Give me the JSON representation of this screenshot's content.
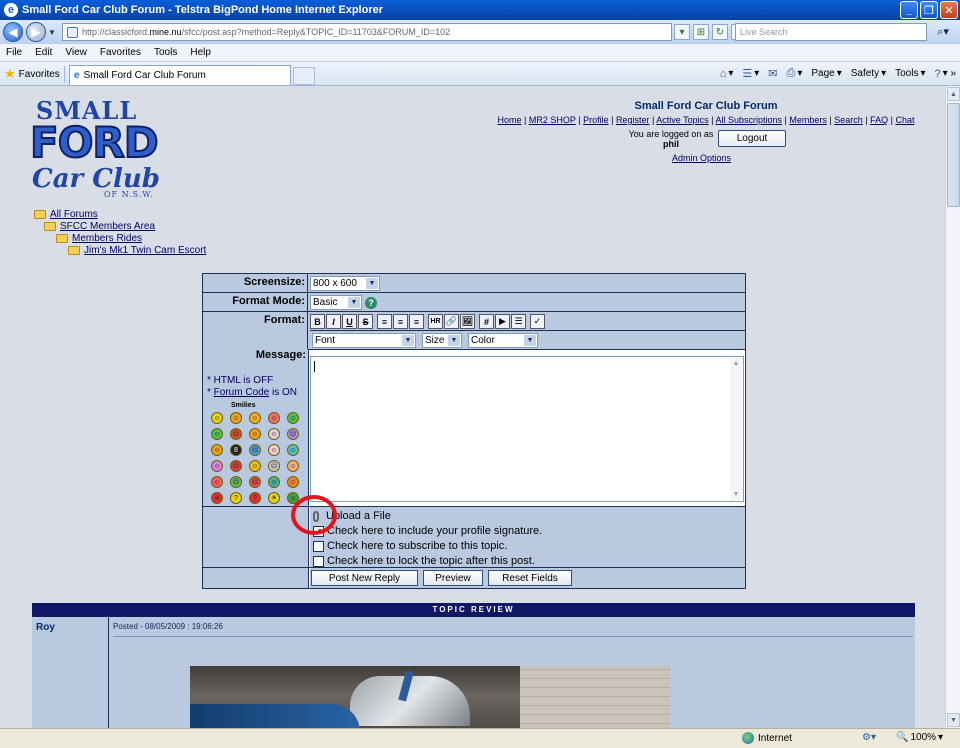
{
  "window": {
    "title": "Small Ford Car Club Forum - Telstra BigPond Home Internet Explorer",
    "minimize_glyph": "_",
    "maximize_glyph": "❐",
    "close_glyph": "✕"
  },
  "address": {
    "url_prefix": "http://classicford.",
    "url_domain": "mine.nu",
    "url_rest": "/sfcc/post.asp?method=Reply&TOPIC_ID=11703&FORUM_ID=102",
    "search_placeholder": "Live Search"
  },
  "menu": [
    "File",
    "Edit",
    "View",
    "Favorites",
    "Tools",
    "Help"
  ],
  "tabbar": {
    "favorites_label": "Favorites",
    "tab_title": "Small Ford Car Club Forum",
    "tools": [
      "Page",
      "Safety",
      "Tools"
    ]
  },
  "logo": {
    "line1": "SMALL",
    "line2": "FORD",
    "line3": "Car Club",
    "line4": "OF N.S.W."
  },
  "header": {
    "forum_title": "Small Ford Car Club Forum",
    "nav": [
      "Home",
      "MR2 SHOP",
      "Profile",
      "Register",
      "Active Topics",
      "All Subscriptions",
      "Members",
      "Search",
      "FAQ",
      "Chat"
    ],
    "logged_on_label": "You are logged on as",
    "username": "phil",
    "logout_label": "Logout",
    "admin_label": "Admin Options"
  },
  "breadcrumb": [
    "All Forums",
    "SFCC Members Area",
    "Members Rides",
    "Jim's Mk1 Twin Cam Escort"
  ],
  "form": {
    "screensize_label": "Screensize:",
    "screensize_value": "800 x 600",
    "format_mode_label": "Format Mode:",
    "format_mode_value": "Basic",
    "format_label": "Format:",
    "format_buttons": [
      "B",
      "I",
      "U",
      "S",
      "≡",
      "≡",
      "≡",
      "HR",
      "🔗",
      "🖼",
      "#",
      "▶",
      "☰",
      "✓"
    ],
    "font_value": "Font",
    "size_value": "Size",
    "color_value": "Color",
    "message_label": "Message:",
    "html_note_prefix": "* HTML is OFF",
    "forum_code_prefix": "* ",
    "forum_code_link": "Forum Code",
    "forum_code_suffix": " is ON",
    "smilies_label": "Smilies",
    "upload_label": "Upload a File",
    "signature_label": "Check here to include your profile signature.",
    "subscribe_label": "Check here to subscribe to this topic.",
    "lock_label": "Check here to lock the topic after this post.",
    "post_button": "Post New Reply",
    "preview_button": "Preview",
    "reset_button": "Reset Fields"
  },
  "review": {
    "header": "TOPIC REVIEW",
    "author": "Roy",
    "posted": "Posted - 08/05/2009 : 19:06:26"
  },
  "status": {
    "zone": "Internet",
    "zoom": "100%"
  }
}
